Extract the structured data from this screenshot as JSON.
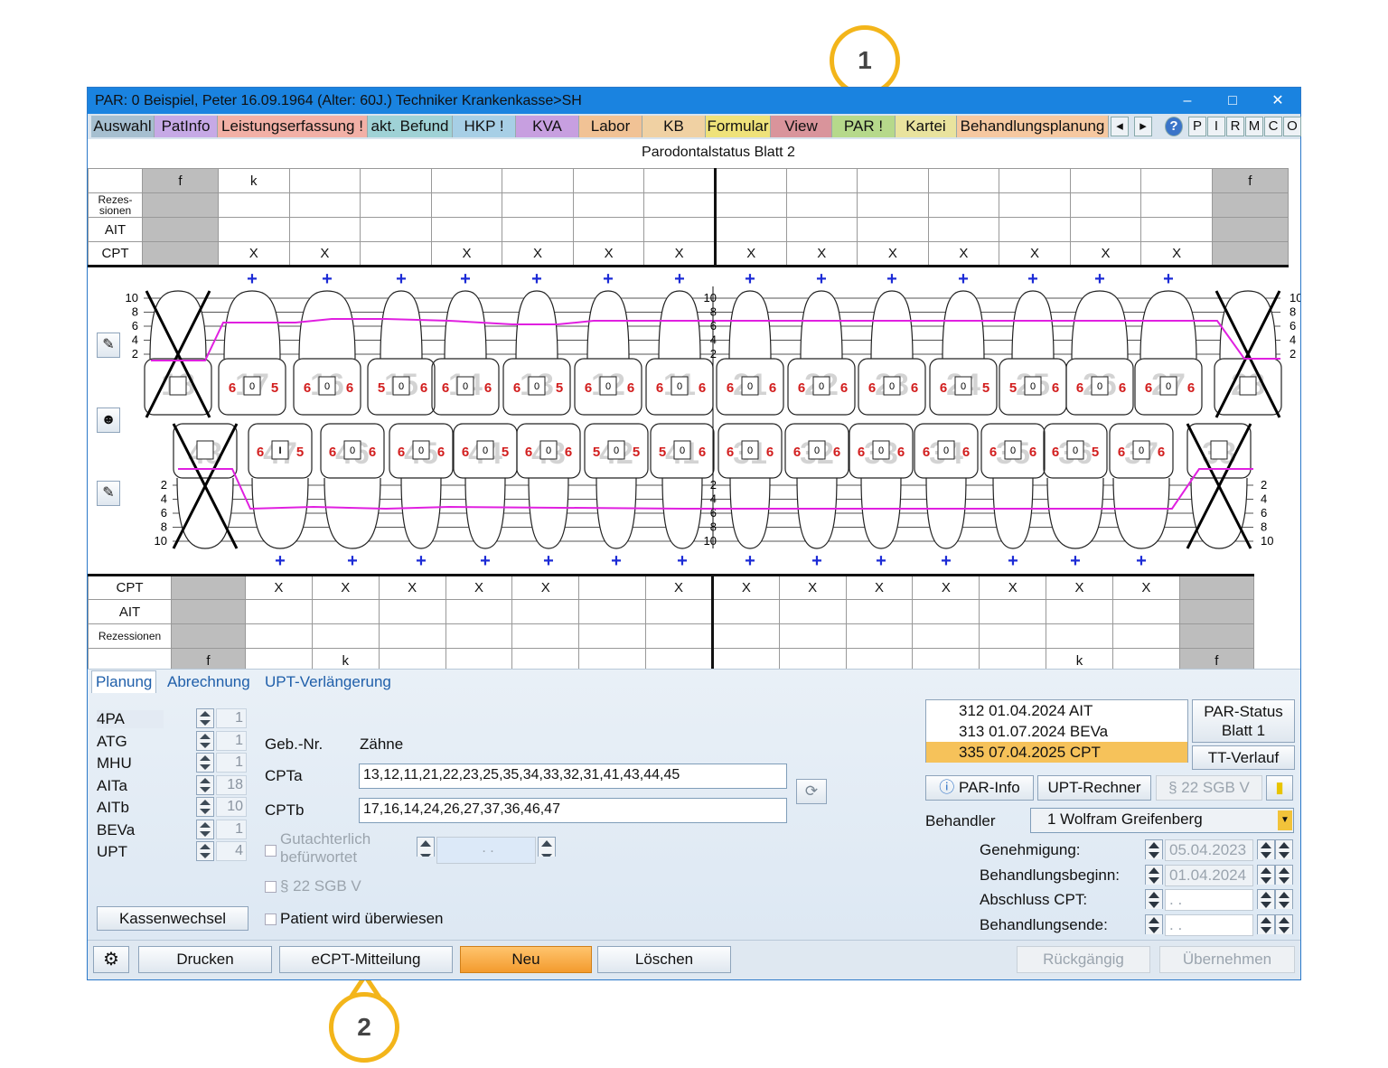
{
  "titlebar": {
    "title": "PAR: 0  Beispiel, Peter  16.09.1964 (Alter: 60J.)  Techniker Krankenkasse>SH",
    "min": "–",
    "max": "□",
    "close": "✕"
  },
  "nav": {
    "tabs": [
      {
        "label": "Auswahl",
        "color": "#a6bfd0"
      },
      {
        "label": "PatInfo",
        "color": "#c6a9e6"
      },
      {
        "label": "Leistungserfassung !",
        "color": "#f2b0a6"
      },
      {
        "label": "akt. Befund",
        "color": "#9fd2d6"
      },
      {
        "label": "HKP !",
        "color": "#a7cfe6"
      },
      {
        "label": "KVA",
        "color": "#c79fe0"
      },
      {
        "label": "Labor",
        "color": "#f1c295"
      },
      {
        "label": "KB",
        "color": "#f0d1a3"
      },
      {
        "label": "Formular",
        "color": "#efe27a"
      },
      {
        "label": "View",
        "color": "#d9949b"
      },
      {
        "label": "PAR !",
        "color": "#b6d98b"
      },
      {
        "label": "Kartei",
        "color": "#e9e39e"
      },
      {
        "label": "Behandlungsplanung",
        "color": "#f6c8a0"
      }
    ],
    "arrows": [
      "◂",
      "▸"
    ],
    "help": "?",
    "letters": [
      "P",
      "I",
      "R",
      "M",
      "C",
      "O"
    ]
  },
  "callouts": [
    "1",
    "2"
  ],
  "sheet_title": "Parodontalstatus Blatt 2",
  "upper": {
    "rows": [
      "",
      "Rezes-\nsionen",
      "AIT",
      "CPT"
    ],
    "f_left": "f",
    "f_right": "f",
    "top_marks": [
      "k",
      "",
      "",
      "",
      "",
      "",
      "",
      "",
      "",
      "",
      "",
      "",
      "",
      ""
    ],
    "cpt": [
      "X",
      "X",
      "",
      "X",
      "X",
      "X",
      "X",
      "X",
      "X",
      "X",
      "X",
      "X",
      "X",
      "X"
    ]
  },
  "lower": {
    "rows": [
      "CPT",
      "AIT",
      "Rezessionen",
      ""
    ],
    "f_left": "f",
    "f_right": "f",
    "cpt": [
      "X",
      "X",
      "X",
      "X",
      "X",
      "",
      "X",
      "X",
      "X",
      "X",
      "X",
      "X",
      "X",
      "X"
    ],
    "bottom_marks": [
      "",
      "k",
      "",
      "",
      "",
      "",
      "",
      "",
      "",
      "",
      "",
      "",
      "k",
      ""
    ]
  },
  "teeth": {
    "upper_numbers": [
      "18",
      "17",
      "16",
      "15",
      "14",
      "13",
      "12",
      "11",
      "21",
      "22",
      "23",
      "24",
      "25",
      "26",
      "27",
      "28"
    ],
    "lower_numbers": [
      "48",
      "47",
      "46",
      "45",
      "44",
      "43",
      "42",
      "41",
      "31",
      "32",
      "33",
      "34",
      "35",
      "36",
      "37",
      "38"
    ],
    "upper_values": [
      [
        "",
        ""
      ],
      [
        "6",
        "5"
      ],
      [
        "6",
        "6"
      ],
      [
        "5",
        "6"
      ],
      [
        "6",
        "6"
      ],
      [
        "6",
        "5"
      ],
      [
        "6",
        "6"
      ],
      [
        "6",
        "6"
      ],
      [
        "6",
        "6"
      ],
      [
        "6",
        "6"
      ],
      [
        "6",
        "6"
      ],
      [
        "6",
        "5"
      ],
      [
        "5",
        "6"
      ],
      [
        "6",
        "6"
      ],
      [
        "6",
        "6"
      ],
      [
        "",
        ""
      ]
    ],
    "lower_values": [
      [
        "",
        ""
      ],
      [
        "6",
        "5"
      ],
      [
        "6",
        "6"
      ],
      [
        "6",
        "6"
      ],
      [
        "6",
        "5"
      ],
      [
        "6",
        "6"
      ],
      [
        "5",
        "5"
      ],
      [
        "5",
        "6"
      ],
      [
        "6",
        "6"
      ],
      [
        "6",
        "6"
      ],
      [
        "6",
        "6"
      ],
      [
        "6",
        "6"
      ],
      [
        "6",
        "6"
      ],
      [
        "6",
        "5"
      ],
      [
        "6",
        "6"
      ],
      [
        "",
        ""
      ]
    ],
    "scale_upper": [
      "10",
      "8",
      "6",
      "4",
      "2"
    ],
    "scale_lower": [
      "2",
      "4",
      "6",
      "8",
      "10"
    ],
    "center": "0",
    "center_special": "I"
  },
  "panel": {
    "tabs": [
      "Planung",
      "Abrechnung",
      "UPT-Verlängerung"
    ],
    "counters": [
      {
        "label": "4PA",
        "value": "1"
      },
      {
        "label": "ATG",
        "value": "1"
      },
      {
        "label": "MHU",
        "value": "1"
      },
      {
        "label": "AITa",
        "value": "18"
      },
      {
        "label": "AITb",
        "value": "10"
      },
      {
        "label": "BEVa",
        "value": "1"
      },
      {
        "label": "UPT",
        "value": "4"
      }
    ],
    "geb_nr": "Geb.-Nr.",
    "zaehne": "Zähne",
    "cpta_label": "CPTa",
    "cpta_value": "13,12,11,21,22,23,25,35,34,33,32,31,41,43,44,45",
    "cptb_label": "CPTb",
    "cptb_value": "17,16,14,24,26,27,37,36,46,47",
    "gutachterlich": "Gutachterlich\nbefürwortet",
    "gutachter_date": " .  . ",
    "sgb22": "§ 22 SGB V",
    "ueberwiesen": "Patient wird überwiesen",
    "kassenwechsel": "Kassenwechsel",
    "list": [
      {
        "text": "312 01.04.2024  AIT",
        "selected": false
      },
      {
        "text": "313 01.07.2024  BEVa",
        "selected": false
      },
      {
        "text": "335 07.04.2025  CPT",
        "selected": true
      }
    ],
    "par_status": "PAR-Status\nBlatt 1",
    "tt_verlauf": "TT-Verlauf",
    "par_info": "PAR-Info",
    "upt_rechner": "UPT-Rechner",
    "sgb22_btn": "§ 22 SGB V",
    "behandler_label": "Behandler",
    "behandler_value": "1 Wolfram Greifenberg",
    "dates": [
      {
        "label": "Genehmigung:",
        "value": "05.04.2023"
      },
      {
        "label": "Behandlungsbeginn:",
        "value": "01.04.2024"
      },
      {
        "label": "Abschluss CPT:",
        "value": " .  . "
      },
      {
        "label": "Behandlungsende:",
        "value": " .  . "
      }
    ]
  },
  "footer": {
    "drucken": "Drucken",
    "ecpt": "eCPT-Mitteilung",
    "neu": "Neu",
    "loeschen": "Löschen",
    "rueckgaengig": "Rückgängig",
    "uebernehmen": "Übernehmen"
  }
}
